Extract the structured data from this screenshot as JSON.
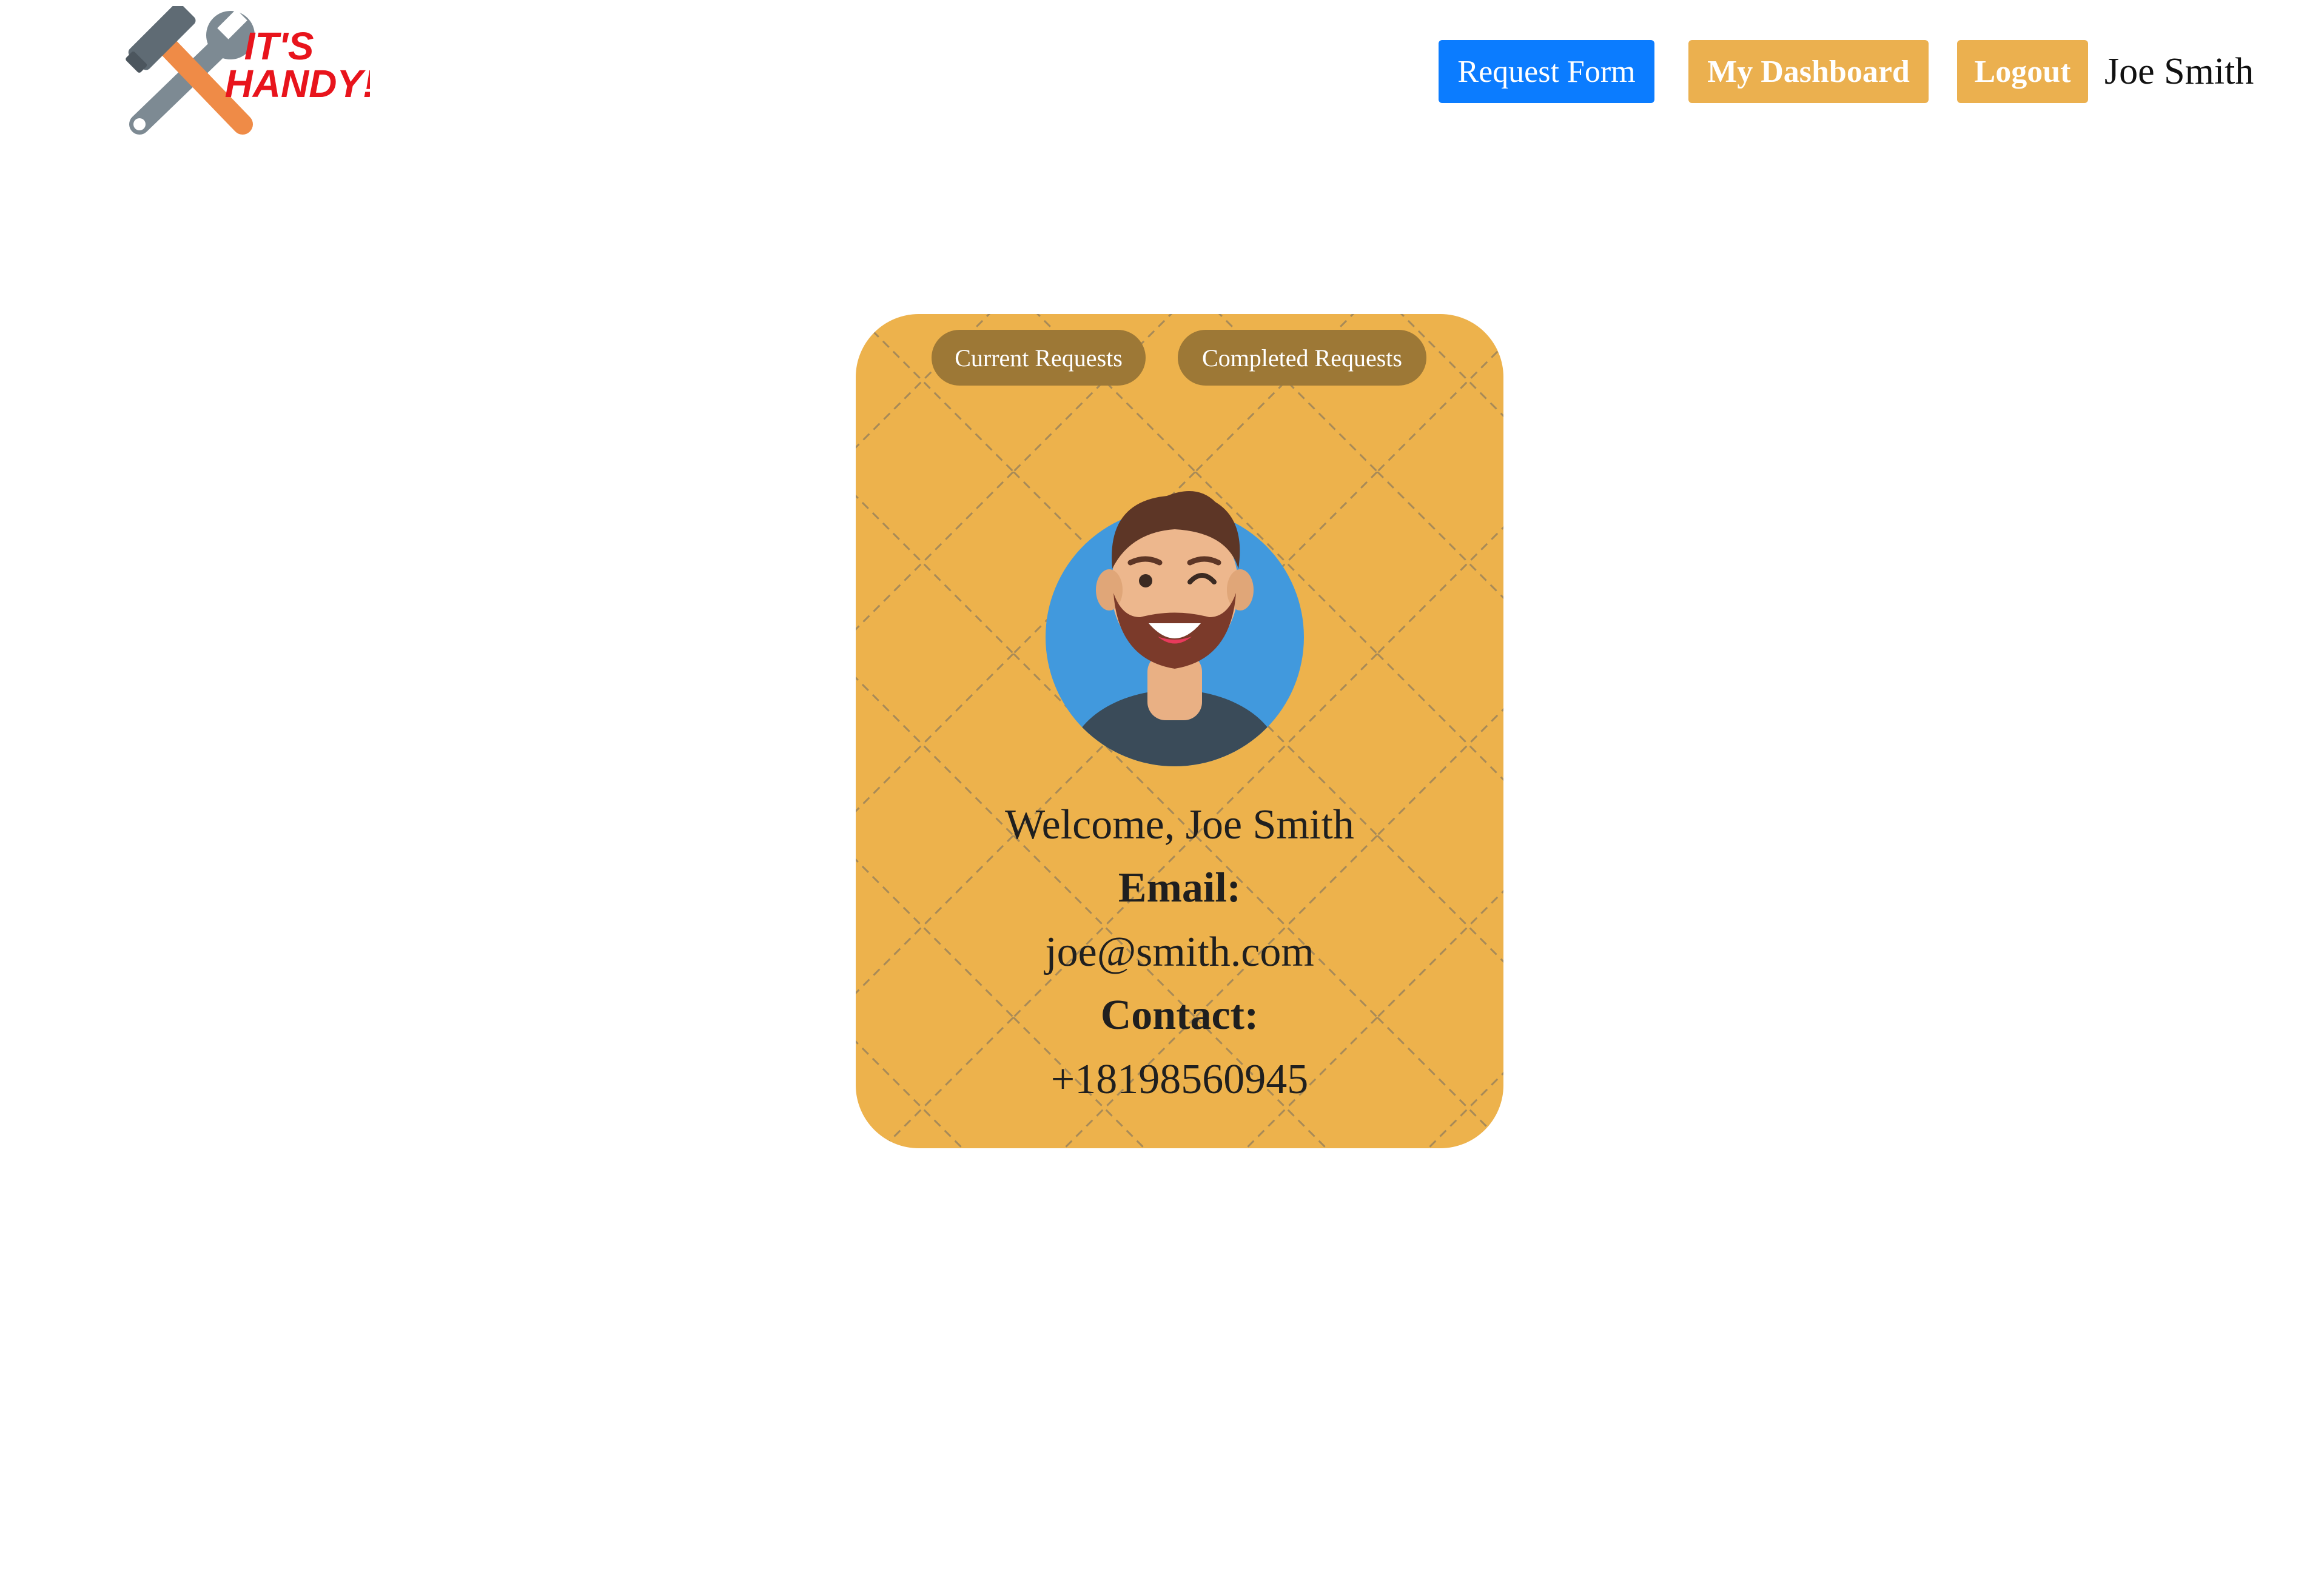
{
  "logo": {
    "line1": "IT'S",
    "line2": "HANDY!"
  },
  "nav": {
    "request_form": "Request Form",
    "my_dashboard": "My Dashboard",
    "logout": "Logout",
    "user_name": "Joe Smith"
  },
  "card": {
    "current_requests": "Current Requests",
    "completed_requests": "Completed Requests",
    "welcome": "Welcome, Joe Smith",
    "email_label": "Email:",
    "email_value": "joe@smith.com",
    "contact_label": "Contact:",
    "contact_value": "+18198560945"
  },
  "colors": {
    "primary_blue": "#0b7cff",
    "accent_yellow": "#ebb04f",
    "card_yellow": "#edb24c",
    "pill_brown": "#9d7836",
    "logo_red": "#e8141c"
  }
}
